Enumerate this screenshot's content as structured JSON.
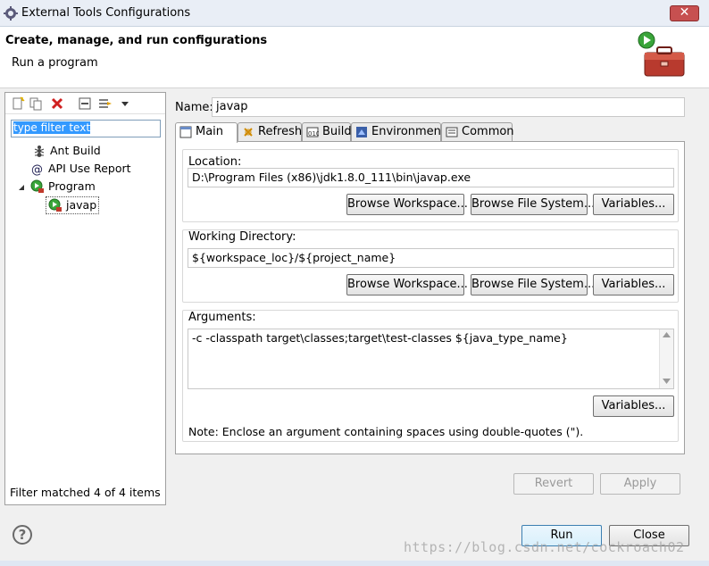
{
  "window": {
    "title": "External Tools Configurations",
    "close_symbol": "✕"
  },
  "header": {
    "title": "Create, manage, and run configurations",
    "subtitle": "Run a program",
    "icon": "toolbox-run-icon"
  },
  "left": {
    "filter_text": "type filter text",
    "tree": [
      {
        "label": "Ant Build",
        "icon": "ant-icon"
      },
      {
        "label": "API Use Report",
        "icon": "api-report-icon"
      },
      {
        "label": "Program",
        "icon": "program-icon",
        "expanded": true
      },
      {
        "label": "javap",
        "icon": "program-config-icon",
        "selected": true
      }
    ],
    "status": "Filter matched 4 of 4 items"
  },
  "name": {
    "label": "Name:",
    "value": "javap"
  },
  "tabs": [
    {
      "label": "Main",
      "icon": "main-tab-icon",
      "active": true
    },
    {
      "label": "Refresh",
      "icon": "refresh-icon"
    },
    {
      "label": "Build",
      "icon": "build-icon"
    },
    {
      "label": "Environment",
      "icon": "environment-icon"
    },
    {
      "label": "Common",
      "icon": "common-icon"
    }
  ],
  "location": {
    "label": "Location:",
    "value": "D:\\Program Files (x86)\\jdk1.8.0_111\\bin\\javap.exe",
    "browse_workspace": "Browse Workspace...",
    "browse_fs": "Browse File System...",
    "variables": "Variables..."
  },
  "working_dir": {
    "label": "Working Directory:",
    "value": "${workspace_loc}/${project_name}",
    "browse_workspace": "Browse Workspace...",
    "browse_fs": "Browse File System...",
    "variables": "Variables..."
  },
  "arguments": {
    "label": "Arguments:",
    "value": "-c -classpath target\\classes;target\\test-classes ${java_type_name}",
    "variables": "Variables...",
    "note": "Note: Enclose an argument containing spaces using double-quotes (\")."
  },
  "actions": {
    "revert": "Revert",
    "apply": "Apply",
    "run": "Run",
    "close": "Close"
  },
  "help_symbol": "?",
  "watermark": "https://blog.csdn.net/cockroach02"
}
